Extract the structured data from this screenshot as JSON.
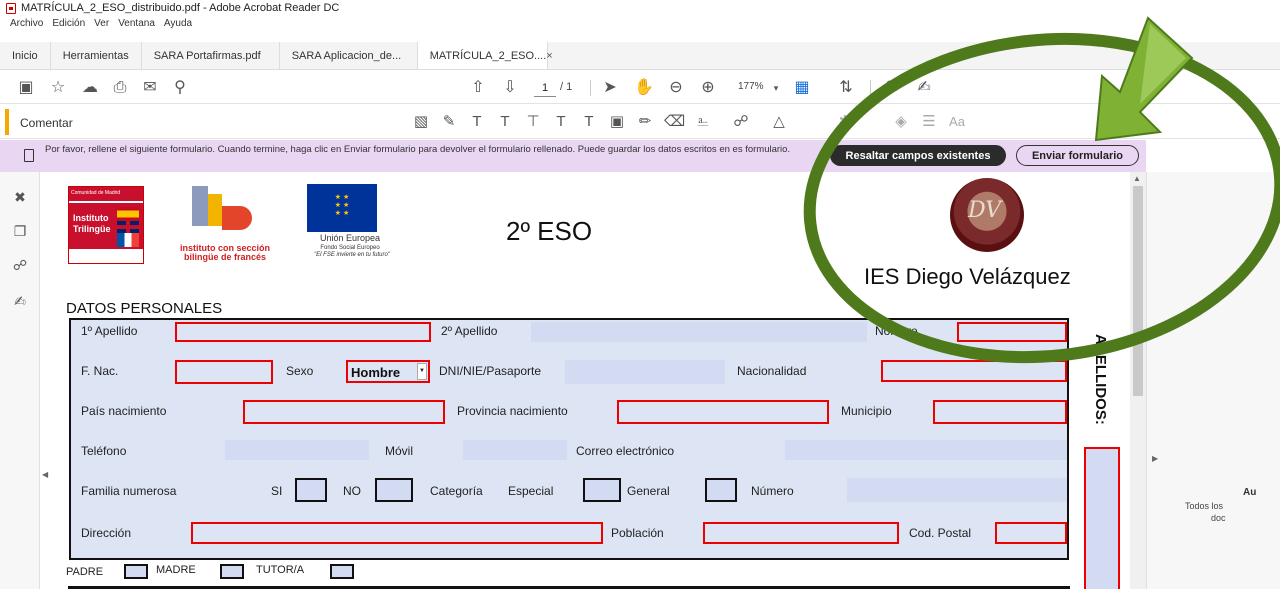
{
  "window": {
    "title": "MATRÍCULA_2_ESO_distribuido.pdf - Adobe Acrobat Reader DC"
  },
  "menu": [
    "Archivo",
    "Edición",
    "Ver",
    "Ventana",
    "Ayuda"
  ],
  "tabs": {
    "home": "Inicio",
    "tools": "Herramientas",
    "file1": "SARA Portafirmas.pdf",
    "file2": "SARA Aplicacion_de...",
    "active": "MATRÍCULA_2_ESO....",
    "close": "×"
  },
  "toolbar": {
    "page_current": "1",
    "page_total": "/ 1",
    "zoom": "177%"
  },
  "comment_bar": {
    "label": "Comentar",
    "text_size_icon": "Aa"
  },
  "notification": {
    "message": "Por favor, rellene el siguiente formulario. Cuando termine, haga clic en Enviar formulario para devolver el formulario rellenado. Puede guardar los datos escritos en es formulario.",
    "highlight_button": "Resaltar campos existentes",
    "submit_button": "Enviar formulario"
  },
  "document": {
    "logo_madrid": {
      "top": "Comunidad de Madrid",
      "line1": "Instituto",
      "line2": "Trilingüe"
    },
    "logo_ib": {
      "text": "instituto con sección bilingüe de francés"
    },
    "logo_eu": {
      "name": "Unión Europea",
      "fund": "Fondo Social Europeo",
      "motto": "\"El FSE invierte en tu futuro\""
    },
    "course": "2º ESO",
    "logo_ies": {
      "initials": "DV"
    },
    "ies_name": "IES Diego Velázquez",
    "section": "DATOS PERSONALES",
    "vertical_label": "APELLIDOS:"
  },
  "form": {
    "apellido1": "1º Apellido",
    "apellido2": "2º Apellido",
    "nombre": "Nombre",
    "fnac": "F. Nac.",
    "sexo": "Sexo",
    "sexo_value": "Hombre",
    "dni": "DNI/NIE/Pasaporte",
    "nacionalidad": "Nacionalidad",
    "pais": "País nacimiento",
    "provincia": "Provincia nacimiento",
    "municipio": "Municipio",
    "telefono": "Teléfono",
    "movil": "Móvil",
    "correo": "Correo electrónico",
    "familia": "Familia numerosa",
    "si": "SI",
    "no": "NO",
    "categoria": "Categoría",
    "especial": "Especial",
    "general": "General",
    "numero": "Número",
    "direccion": "Dirección",
    "poblacion": "Población",
    "cp": "Cod. Postal"
  },
  "below": {
    "padre": "PADRE",
    "madre": "MADRE",
    "tutor": "TUTOR/A"
  },
  "right_panel": {
    "title": "Au",
    "line1": "Todos los",
    "line2": "doc"
  },
  "colors": {
    "required_border": "#e00000",
    "field_bg": "#dde4f3",
    "accent_green": "#4f7a1c",
    "notify_bg": "#e9d6f2"
  }
}
